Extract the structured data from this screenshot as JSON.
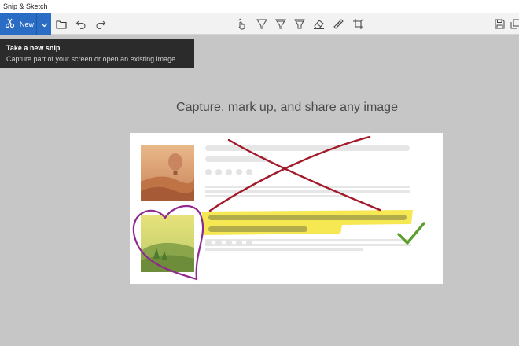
{
  "app": {
    "title": "Snip & Sketch"
  },
  "toolbar": {
    "new_label": "New",
    "icons": [
      "snip-icon",
      "new-dropdown-icon",
      "open-folder-icon",
      "undo-icon",
      "redo-icon",
      "touch-writing-icon",
      "ballpoint-pen-icon",
      "pencil-icon",
      "highlighter-icon",
      "eraser-icon",
      "ruler-icon",
      "crop-icon",
      "save-icon",
      "copy-icon"
    ]
  },
  "tooltip": {
    "title": "Take a new snip",
    "description": "Capture part of your screen or open an existing image"
  },
  "main": {
    "heading": "Capture, mark up, and share any image"
  },
  "colors": {
    "accent": "#2b6cc4",
    "background": "#c6c6c6",
    "annotation_red": "#a3192a",
    "annotation_purple": "#8e2a8e",
    "highlight_yellow": "#f4e640",
    "check_green": "#5e9e2e"
  }
}
